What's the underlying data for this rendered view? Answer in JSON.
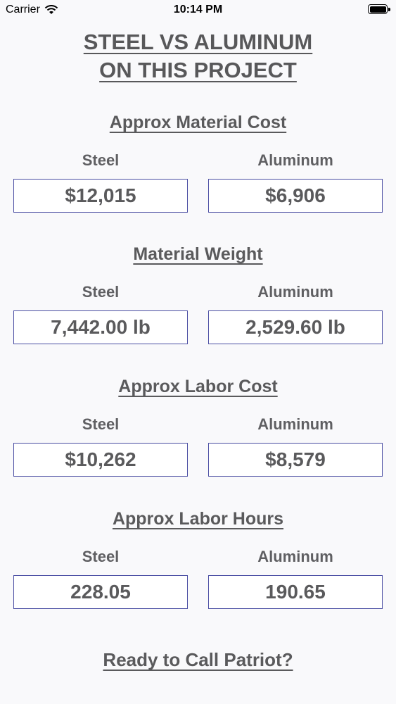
{
  "status_bar": {
    "carrier": "Carrier",
    "time": "10:14 PM"
  },
  "title": {
    "line1": "STEEL VS ALUMINUM",
    "line2": "ON THIS PROJECT"
  },
  "sections": [
    {
      "heading": "Approx Material Cost",
      "steel_label": "Steel",
      "aluminum_label": "Aluminum",
      "steel_value": "$12,015",
      "aluminum_value": "$6,906"
    },
    {
      "heading": "Material Weight",
      "steel_label": "Steel",
      "aluminum_label": "Aluminum",
      "steel_value": "7,442.00 lb",
      "aluminum_value": "2,529.60 lb"
    },
    {
      "heading": "Approx Labor Cost",
      "steel_label": "Steel",
      "aluminum_label": "Aluminum",
      "steel_value": "$10,262",
      "aluminum_value": "$8,579"
    },
    {
      "heading": "Approx Labor Hours",
      "steel_label": "Steel",
      "aluminum_label": "Aluminum",
      "steel_value": "228.05",
      "aluminum_value": "190.65"
    }
  ],
  "cta": {
    "label": "Ready to Call Patriot?"
  },
  "colors": {
    "background": "#f9f9fb",
    "text": "#58585a",
    "box_border": "#4a4ea3"
  }
}
